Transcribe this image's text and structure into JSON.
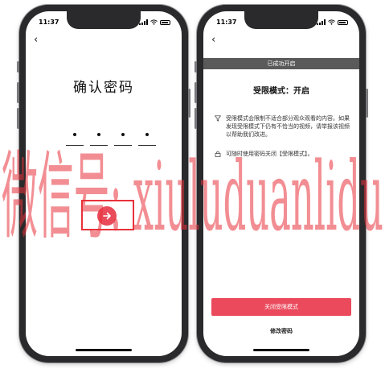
{
  "left_phone": {
    "status": {
      "time": "11:37"
    },
    "back_icon": "‹",
    "title": "确认密码",
    "password_digits": 4,
    "next_icon": "arrow-right-icon"
  },
  "right_phone": {
    "status": {
      "time": "11:37"
    },
    "back_icon": "‹",
    "toast": "已成功开启",
    "title": "受限模式：开启",
    "info_items": [
      {
        "icon": "filter-icon",
        "text": "受限模式会限制不适合部分观众观看的内容。如果发现受限模式下仍有不恰当的视频，请举报该视频以帮助我们改进。"
      },
      {
        "icon": "lock-icon",
        "text": "可随时使用密码关闭【受限模式】。"
      }
    ],
    "close_button": "关闭受限模式",
    "change_password": "修改密码"
  },
  "watermark": {
    "text": "微信号: xiuluduanlidu",
    "color": "#e8323a"
  },
  "colors": {
    "accent": "#e94b5a",
    "highlight_box": "#e8323a",
    "toast_bg": "#5a5a5a"
  }
}
